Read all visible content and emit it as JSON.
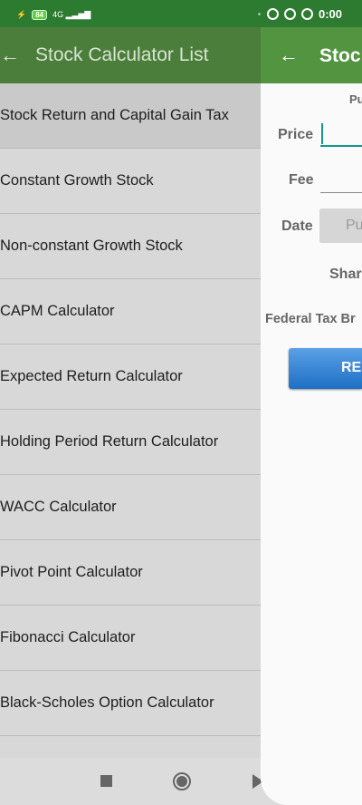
{
  "status": {
    "battery": "84",
    "network": "4G",
    "time": "0:00"
  },
  "list_screen": {
    "title": "Stock Calculator List",
    "items": [
      "Stock Return and Capital Gain Tax",
      "Constant Growth Stock",
      "Non-constant Growth Stock",
      "CAPM Calculator",
      "Expected Return Calculator",
      "Holding Period Return Calculator",
      "WACC Calculator",
      "Pivot Point Calculator",
      "Fibonacci Calculator",
      "Black-Scholes Option Calculator",
      ""
    ]
  },
  "calc_screen": {
    "title": "Stoc",
    "section": "Pu",
    "price_label": "Price",
    "price_value": "",
    "fee_label": "Fee",
    "fee_value": "",
    "date_label": "Date",
    "date_button": "Pu",
    "shares_label": "Shar",
    "tax_label": "Federal Tax Br",
    "reset_button": "RES"
  }
}
